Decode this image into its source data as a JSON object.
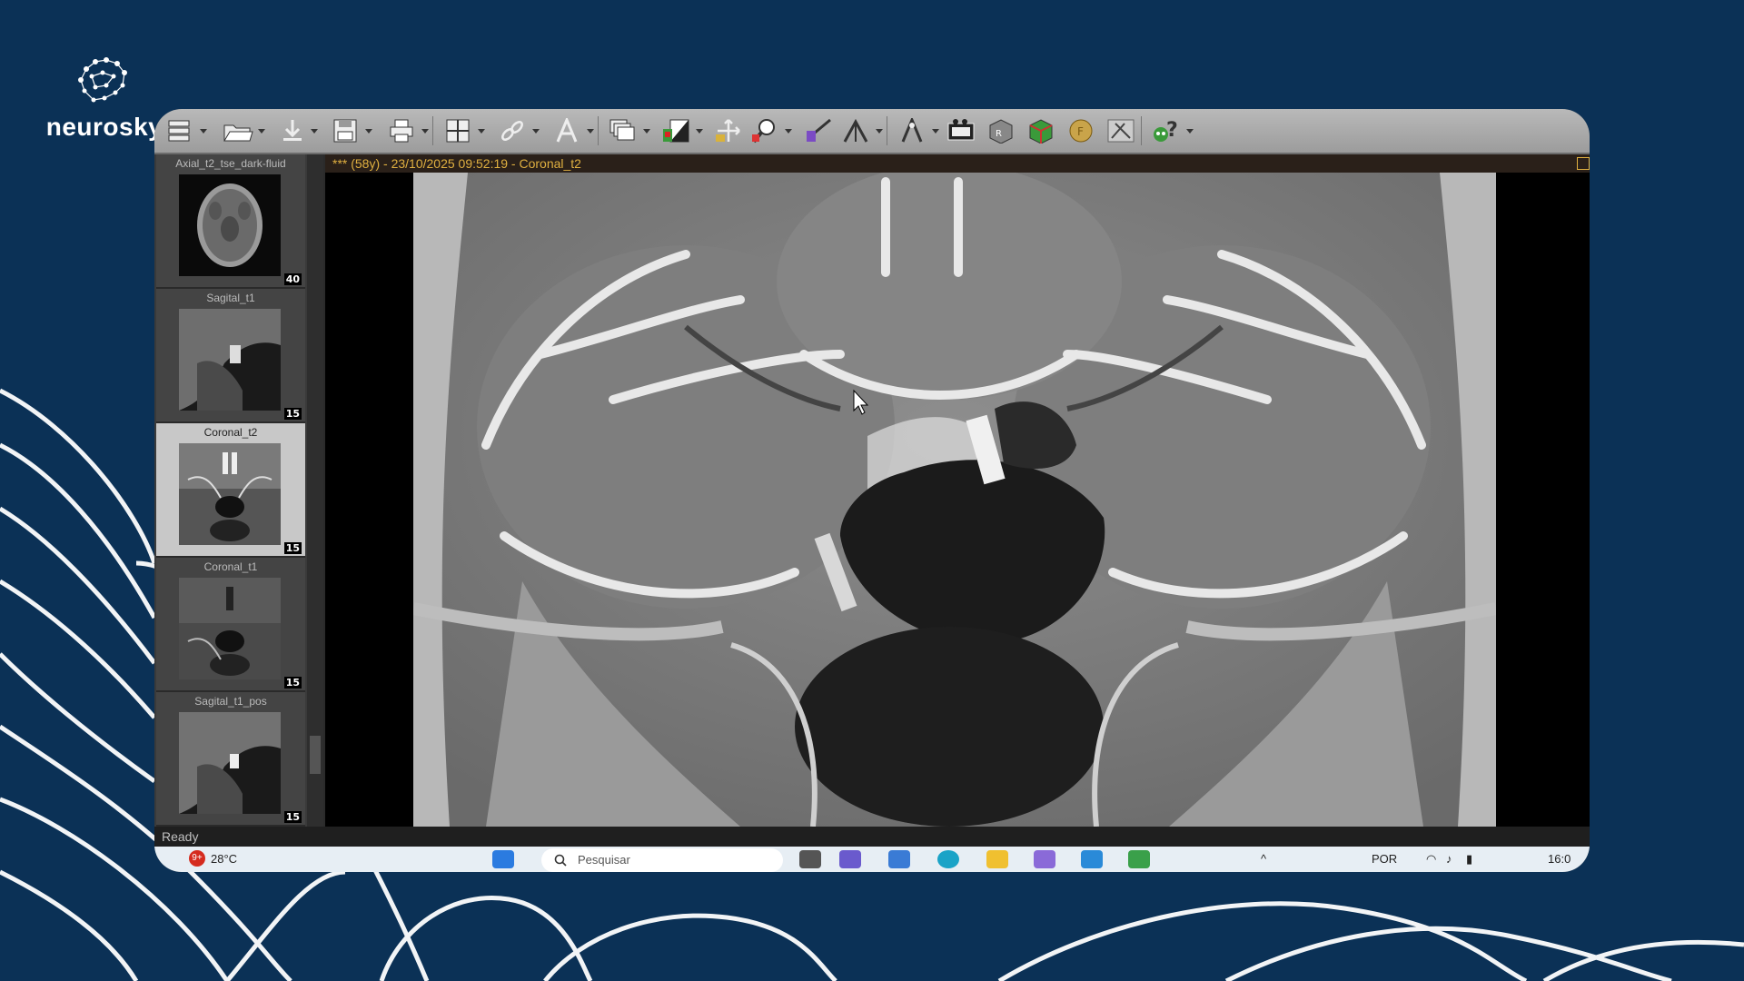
{
  "brand": {
    "name": "neurosky"
  },
  "toolbar": {
    "buttons": [
      "database-icon",
      "open-folder-icon",
      "download-icon",
      "save-icon",
      "print-icon",
      "layout-grid-icon",
      "link-icon",
      "text-annotation-icon",
      "stack-icon",
      "window-level-icon",
      "pan-icon",
      "zoom-icon",
      "measure-icon",
      "reference-lines-icon",
      "cine-icon",
      "mpr-icon",
      "3d-icon",
      "fusion-icon",
      "cut-tool-icon",
      "help-icon"
    ]
  },
  "series": [
    {
      "label": "Axial_t2_tse_dark-fluid",
      "count": "40",
      "active": false,
      "view": "axial"
    },
    {
      "label": "Sagital_t1",
      "count": "15",
      "active": false,
      "view": "sagittal"
    },
    {
      "label": "Coronal_t2",
      "count": "15",
      "active": true,
      "view": "coronal"
    },
    {
      "label": "Coronal_t1",
      "count": "15",
      "active": false,
      "view": "coronal"
    },
    {
      "label": "Sagital_t1_pos",
      "count": "15",
      "active": false,
      "view": "sagittal"
    }
  ],
  "viewer": {
    "header": "*** (58y) - 23/10/2025 09:52:19 - Coronal_t2"
  },
  "status": {
    "text": "Ready"
  },
  "taskbar": {
    "weather_badge": "9+",
    "temperature": "28°C",
    "search_placeholder": "Pesquisar",
    "language": "POR",
    "clock": "16:0"
  }
}
